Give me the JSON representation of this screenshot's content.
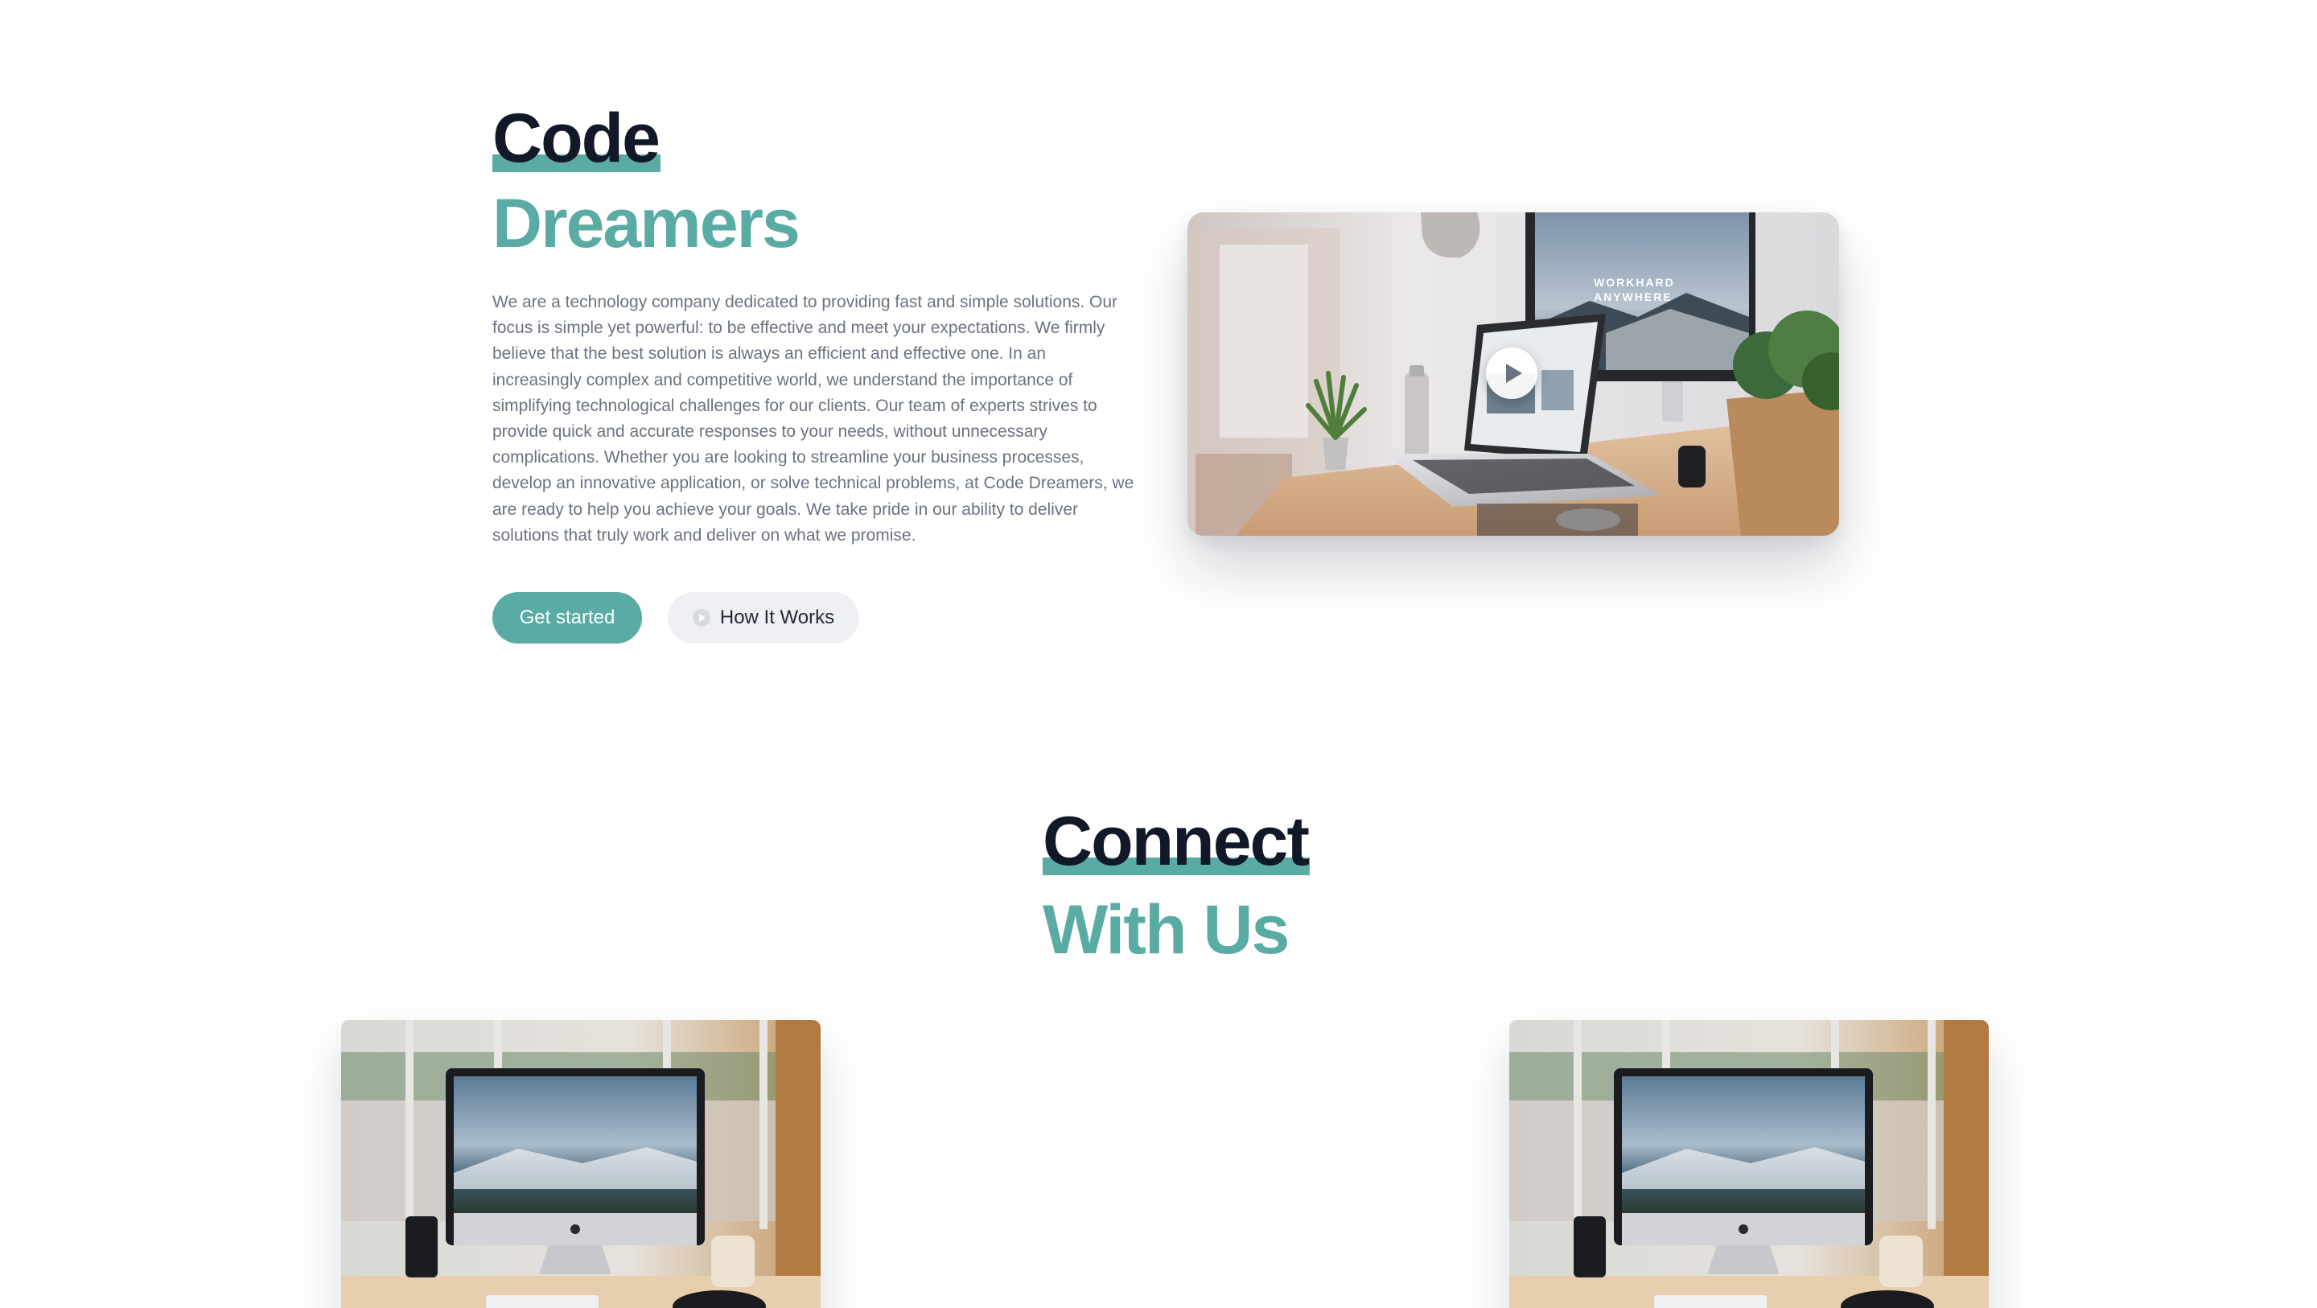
{
  "hero": {
    "title_line1": "Code",
    "title_line2": "Dreamers",
    "description": "We are a technology company dedicated to providing fast and simple solutions. Our focus is simple yet powerful: to be effective and meet your expectations. We firmly believe that the best solution is always an efficient and effective one. In an increasingly complex and competitive world, we understand the importance of simplifying technological challenges for our clients. Our team of experts strives to provide quick and accurate responses to your needs, without unnecessary complications. Whether you are looking to streamline your business processes, develop an innovative application, or solve technical problems, at Code Dreamers, we are ready to help you achieve your goals. We take pride in our ability to deliver solutions that truly work and deliver on what we promise.",
    "primary_button": "Get started",
    "secondary_button": "How It Works",
    "screen_text_line1": "WORKHARD",
    "screen_text_line2": "ANYWHERE"
  },
  "connect": {
    "title_line1": "Connect",
    "title_line2": "With Us"
  },
  "colors": {
    "accent": "#5aaba3",
    "heading": "#111827",
    "body_text": "#6b7280",
    "secondary_button_bg": "#eef0f3"
  },
  "icons": {
    "hero_video": "play-icon",
    "secondary_button": "play-circle-icon"
  }
}
